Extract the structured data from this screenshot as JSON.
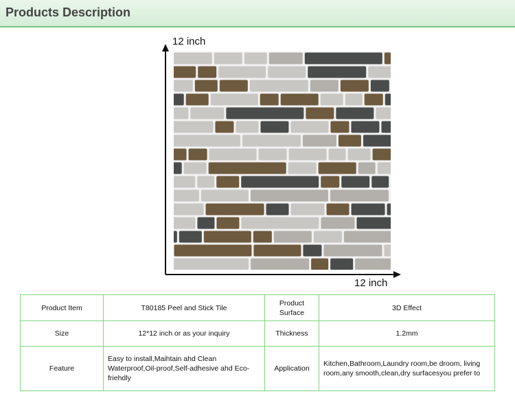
{
  "header": {
    "title": "Products Description"
  },
  "figure": {
    "height_label": "12 inch",
    "width_label": "12 inch",
    "colors": {
      "brown_glass": "#6e5a3e",
      "dark_marble": "#4a4c4c",
      "light_stone": "#c9c7c4",
      "grout": "#f2f2f2"
    }
  },
  "table": {
    "rows": [
      [
        {
          "label": "Product Item",
          "value": "T80185 Peel and Stick Tile"
        },
        {
          "label": "Product Surface",
          "value": "3D Effect"
        }
      ],
      [
        {
          "label": "Size",
          "value": "12*12 inch or as your inquiry"
        },
        {
          "label": "Thickness",
          "value": "1.2mm"
        }
      ],
      [
        {
          "label": "Feature",
          "value": "Easy to install,Maihtain ahd Clean Waterproof,Oil-proof,Self-adhesive ahd Eco-friehdly"
        },
        {
          "label": "Application",
          "value": "Kitchen,Bathroom,Laundry room,be droom, living room,any smooth,clean,dry surfacesyou prefer to"
        }
      ]
    ]
  }
}
